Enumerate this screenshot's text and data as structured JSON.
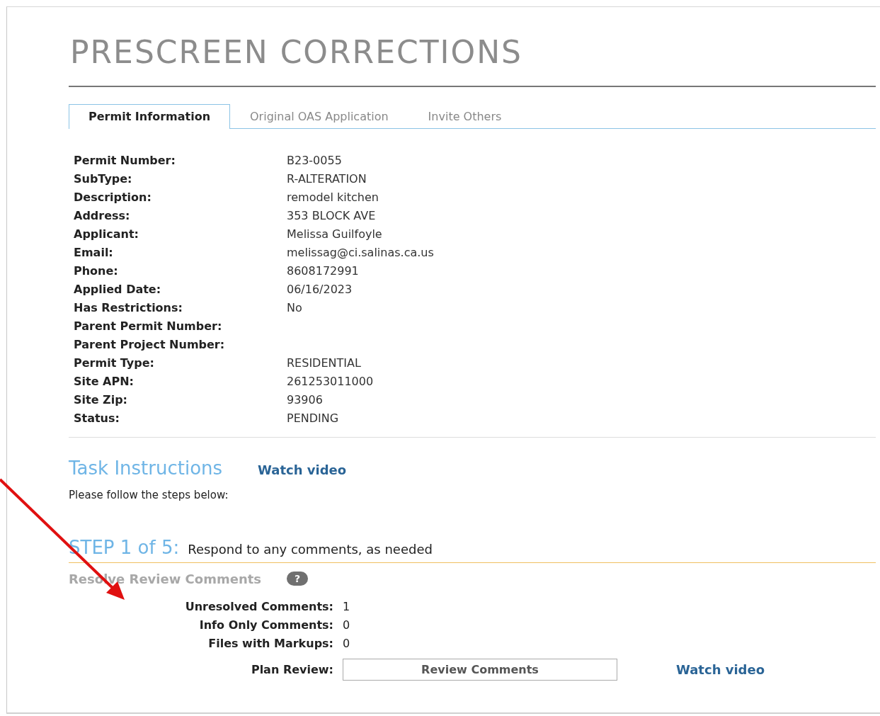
{
  "title": "PRESCREEN CORRECTIONS",
  "tabs": [
    {
      "label": "Permit Information",
      "selected": true
    },
    {
      "label": "Original OAS Application",
      "selected": false
    },
    {
      "label": "Invite Others",
      "selected": false
    }
  ],
  "permit_fields": [
    {
      "label": "Permit Number:",
      "value": "B23-0055"
    },
    {
      "label": "SubType:",
      "value": "R-ALTERATION"
    },
    {
      "label": "Description:",
      "value": "remodel kitchen"
    },
    {
      "label": "Address:",
      "value": "353 BLOCK AVE"
    },
    {
      "label": "Applicant:",
      "value": "Melissa Guilfoyle"
    },
    {
      "label": "Email:",
      "value": "melissag@ci.salinas.ca.us"
    },
    {
      "label": "Phone:",
      "value": "8608172991"
    },
    {
      "label": "Applied Date:",
      "value": "06/16/2023"
    },
    {
      "label": "Has Restrictions:",
      "value": "No"
    },
    {
      "label": "Parent Permit Number:"
    },
    {
      "label": "Parent Project Number:"
    },
    {
      "label": "Permit Type:",
      "value": "RESIDENTIAL"
    },
    {
      "label": "Site APN:",
      "value": "261253011000"
    },
    {
      "label": "Site Zip:",
      "value": "93906"
    },
    {
      "label": "Status:",
      "value": "PENDING"
    }
  ],
  "task_instructions": {
    "heading": "Task Instructions",
    "video_link": "Watch video",
    "text": "Please follow the steps below:"
  },
  "step": {
    "number": "STEP 1 of 5:",
    "description": "Respond to any comments, as needed",
    "section_title": "Resolve Review Comments",
    "help": "?",
    "counts": [
      {
        "label": "Unresolved Comments:",
        "value": "1"
      },
      {
        "label": "Info Only Comments:",
        "value": "0"
      },
      {
        "label": "Files with Markups:",
        "value": "0"
      }
    ],
    "plan_review": {
      "label": "Plan Review:",
      "button": "Review Comments",
      "video_link": "Watch video"
    }
  }
}
